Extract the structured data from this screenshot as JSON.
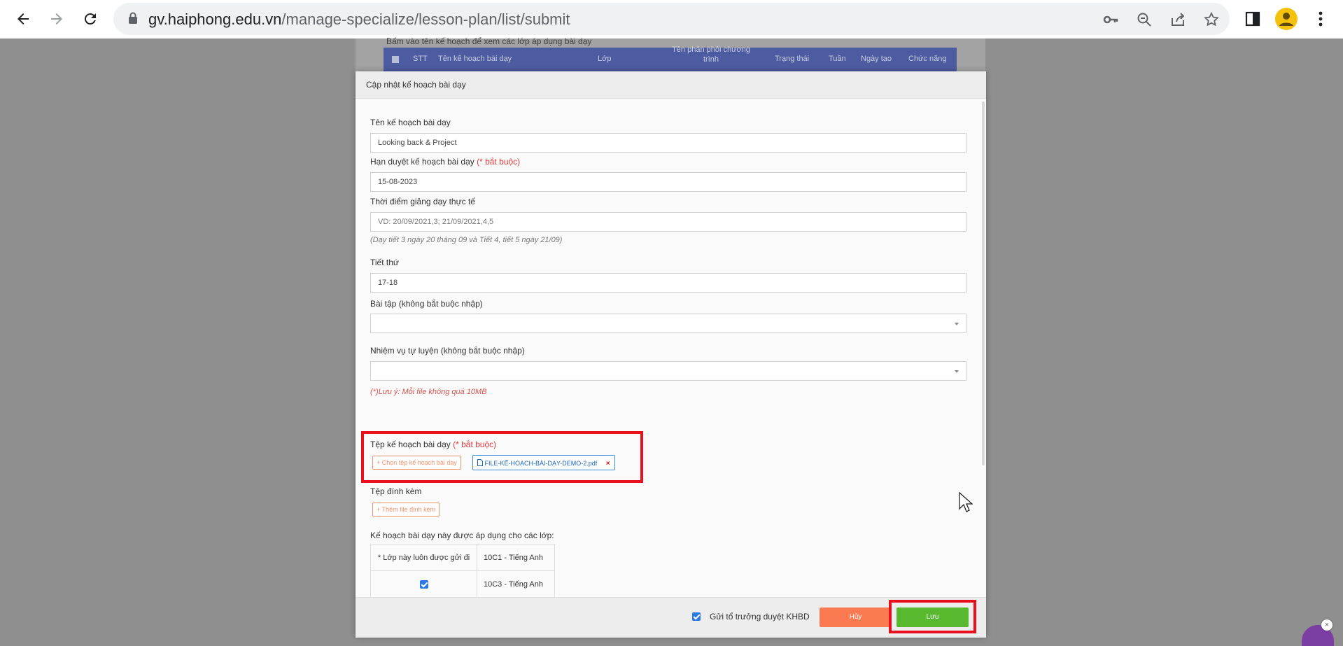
{
  "browser": {
    "url_host": "gv.haiphong.edu.vn",
    "url_path": "/manage-specialize/lesson-plan/list/submit"
  },
  "background_page": {
    "hint": "Bấm vào tên kế hoạch để xem các lớp áp dụng bài dạy",
    "table_headers": [
      "STT",
      "Tên kế hoạch bài dạy",
      "Lớp",
      "Tên phân phối chương trình",
      "Trạng thái",
      "Tuần",
      "Ngày tạo",
      "Chức năng"
    ]
  },
  "modal": {
    "title": "Cập nhật kế hoạch bài dạy",
    "lesson_name": {
      "label": "Tên kế hoạch bài dạy",
      "value": "Looking back & Project"
    },
    "deadline": {
      "label": "Hạn duyệt kế hoạch bài dạy",
      "required": "(* bắt buộc)",
      "value": "15-08-2023"
    },
    "teaching_time": {
      "label": "Thời điểm giảng dạy thực tế",
      "placeholder": "VD: 20/09/2021,3; 21/09/2021,4,5",
      "hint": "(Dạy tiết 3 ngày 20 tháng 09 và Tiết 4, tiết 5 ngày 21/09)"
    },
    "period": {
      "label": "Tiết thứ",
      "value": "17-18"
    },
    "exercise": {
      "label": "Bài tập (không bắt buộc nhập)",
      "value": ""
    },
    "self_study": {
      "label": "Nhiệm vụ tự luyện (không bắt buộc nhập)",
      "value": ""
    },
    "file_note": "(*)Lưu ý: Mỗi file không quá 10MB",
    "plan_file": {
      "label": "Tệp kế hoạch bài dạy",
      "required": "(* bắt buộc)",
      "choose_button": "+ Chọn tệp kế hoạch bài dạy",
      "file_name": "FILE-KẾ-HOẠCH-BÀI-DẠY-DEMO-2.pdf",
      "remove_symbol": "×"
    },
    "attachments": {
      "label": "Tệp đính kèm",
      "add_button": "+ Thêm file đính kèm"
    },
    "classes": {
      "label": "Kế hoạch bài dạy này được áp dụng cho các lớp:",
      "note": "* Lớp này luôn được gửi đi",
      "rows": [
        "10C1 - Tiếng Anh",
        "10C3 - Tiếng Anh"
      ],
      "second_row_checked": true
    },
    "footer": {
      "send_to_head_label": "Gửi tổ trưởng duyệt KHBD",
      "send_checked": true,
      "cancel_label": "Hủy",
      "save_label": "Lưu"
    }
  },
  "colors": {
    "cancel": "#fb7a52",
    "save": "#58b82e",
    "highlight": "#e8101c",
    "required": "#e03c3c",
    "table_header": "#4d5ba0"
  }
}
